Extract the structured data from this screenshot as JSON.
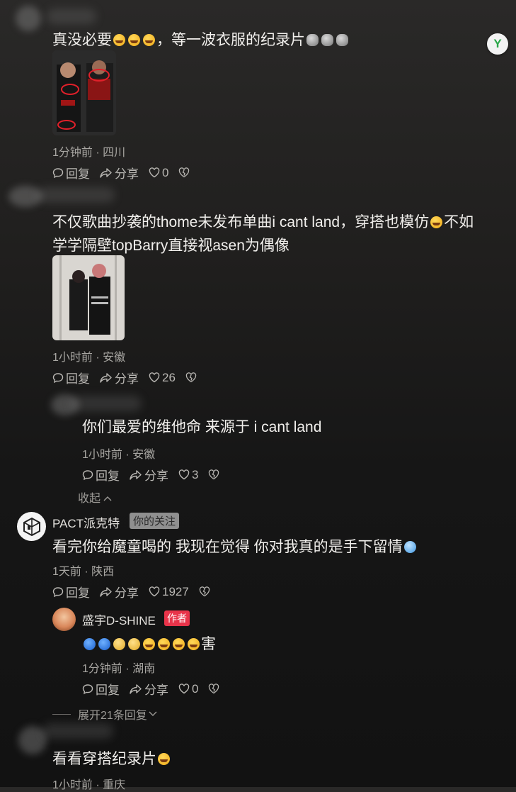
{
  "comments": [
    {
      "text_parts": [
        "真没必要",
        "，等一波衣服的纪录片"
      ],
      "time_loc": "1分钟前 · 四川",
      "reply_label": "回复",
      "share_label": "分享",
      "likes": "0"
    },
    {
      "text_line1": "不仅歌曲抄袭的thome未发布单曲i cant land，穿搭也模仿",
      "text_line1_tail": "不如",
      "text_line2": "学学隔壁topBarry直接视asen为偶像",
      "time_loc": "1小时前 · 安徽",
      "reply_label": "回复",
      "share_label": "分享",
      "likes": "26"
    },
    {
      "text": "你们最爱的维他命 来源于 i cant land",
      "time_loc": "1小时前 · 安徽",
      "reply_label": "回复",
      "share_label": "分享",
      "likes": "3",
      "collapse_label": "收起"
    },
    {
      "username": "PACT派克特",
      "tag": "你的关注",
      "text": "看完你给魔童喝的 我现在觉得 你对我真的是手下留情",
      "time_loc": "1天前 · 陕西",
      "reply_label": "回复",
      "share_label": "分享",
      "likes": "1927"
    },
    {
      "username": "盛宇D-SHINE",
      "tag": "作者",
      "text_tail": "害",
      "time_loc": "1分钟前 · 湖南",
      "reply_label": "回复",
      "share_label": "分享",
      "likes": "0",
      "expand_label": "展开21条回复"
    },
    {
      "text": "看看穿搭纪录片",
      "time_loc": "1小时前 · 重庆"
    }
  ],
  "badge": "Y",
  "colors": {
    "author_tag": "#e8344a",
    "follow_tag": "#8f8f8f"
  }
}
